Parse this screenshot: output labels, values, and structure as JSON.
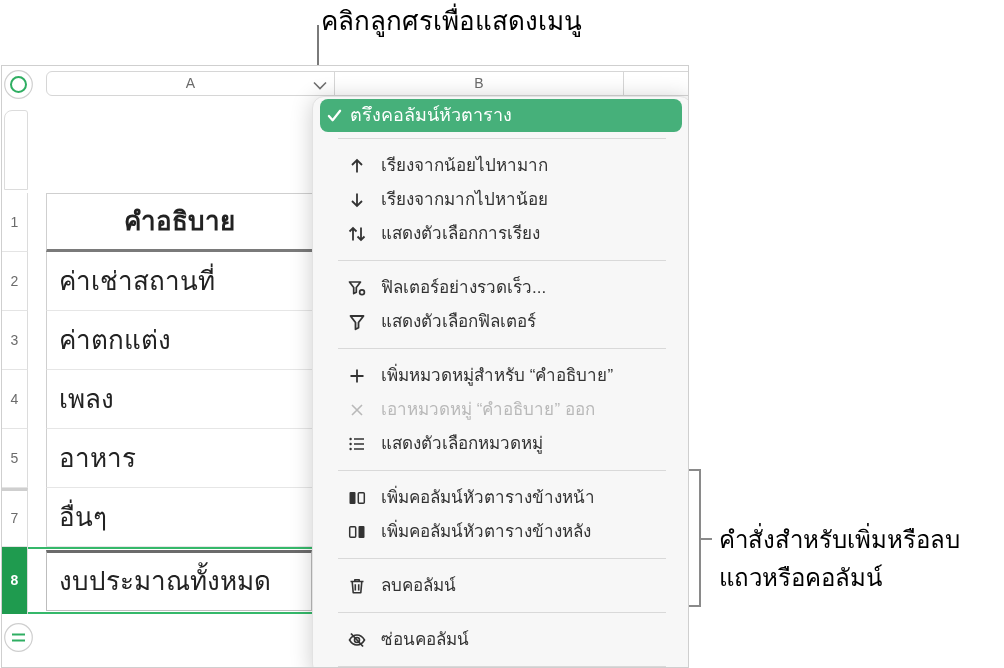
{
  "annotations": {
    "top": {
      "text": "คลิกลูกศรเพื่อแสดงเมนู"
    },
    "side": {
      "text": "คำสั่งสำหรับเพิ่มหรือลบ\nแถวหรือคอลัมน์"
    }
  },
  "columns": [
    {
      "label": "A",
      "dropdown": true
    },
    {
      "label": "B",
      "dropdown": false
    }
  ],
  "rows": [
    {
      "number": "1",
      "kind": "header",
      "cell": "คำอธิบาย",
      "selected": false,
      "hidden_before": false
    },
    {
      "number": "2",
      "kind": "body",
      "cell": "ค่าเช่าสถานที่",
      "selected": false,
      "hidden_before": false
    },
    {
      "number": "3",
      "kind": "body",
      "cell": "ค่าตกแต่ง",
      "selected": false,
      "hidden_before": false
    },
    {
      "number": "4",
      "kind": "body",
      "cell": "เพลง",
      "selected": false,
      "hidden_before": false
    },
    {
      "number": "5",
      "kind": "body",
      "cell": "อาหาร",
      "selected": false,
      "hidden_before": false
    },
    {
      "number": "7",
      "kind": "body",
      "cell": "อื่นๆ",
      "selected": false,
      "hidden_before": true
    },
    {
      "number": "8",
      "kind": "footer",
      "cell": "งบประมาณทั้งหมด",
      "selected": true,
      "hidden_before": false
    }
  ],
  "menu": {
    "sections": [
      {
        "items": [
          {
            "label": "ตรึงคอลัมน์หัวตาราง",
            "kind": "toggle",
            "checked": true,
            "selected": true,
            "disabled": false
          }
        ]
      },
      {
        "items": [
          {
            "label": "เรียงจากน้อยไปหามาก",
            "kind": "ascending",
            "checked": false,
            "selected": false,
            "disabled": false
          },
          {
            "label": "เรียงจากมากไปหาน้อย",
            "kind": "descending",
            "checked": false,
            "selected": false,
            "disabled": false
          },
          {
            "label": "แสดงตัวเลือกการเรียง",
            "kind": "sortoptions",
            "checked": false,
            "selected": false,
            "disabled": false
          }
        ]
      },
      {
        "items": [
          {
            "label": "ฟิลเตอร์อย่างรวดเร็ว...",
            "kind": "quickfilter",
            "checked": false,
            "selected": false,
            "disabled": false
          },
          {
            "label": "แสดงตัวเลือกฟิลเตอร์",
            "kind": "filter",
            "checked": false,
            "selected": false,
            "disabled": false
          }
        ]
      },
      {
        "items": [
          {
            "label": "เพิ่มหมวดหมู่สำหรับ “คำอธิบาย”",
            "kind": "add",
            "checked": false,
            "selected": false,
            "disabled": false
          },
          {
            "label": "เอาหมวดหมู่ “คำอธิบาย” ออก",
            "kind": "remove",
            "checked": false,
            "selected": false,
            "disabled": true
          },
          {
            "label": "แสดงตัวเลือกหมวดหมู่",
            "kind": "categories",
            "checked": false,
            "selected": false,
            "disabled": false
          }
        ]
      },
      {
        "items": [
          {
            "label": "เพิ่มคอลัมน์หัวตารางข้างหน้า",
            "kind": "insertbefore",
            "checked": false,
            "selected": false,
            "disabled": false
          },
          {
            "label": "เพิ่มคอลัมน์หัวตารางข้างหลัง",
            "kind": "insertafter",
            "checked": false,
            "selected": false,
            "disabled": false
          }
        ]
      },
      {
        "items": [
          {
            "label": "ลบคอลัมน์",
            "kind": "delete",
            "checked": false,
            "selected": false,
            "disabled": false
          }
        ]
      },
      {
        "items": [
          {
            "label": "ซ่อนคอลัมน์",
            "kind": "hide",
            "checked": false,
            "selected": false,
            "disabled": false
          }
        ]
      }
    ]
  }
}
